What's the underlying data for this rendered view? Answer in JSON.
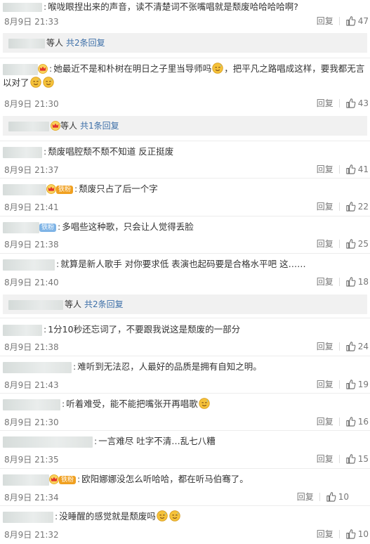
{
  "comments": [
    {
      "text": "喉咙眼捏出来的声音，读不清楚词不张嘴唱就是颓废哈哈哈哈啊?",
      "date": "8月9日 21:33",
      "reply": "回复",
      "likes": "47"
    },
    {
      "text": "她最近不是和朴树在明日之子里当导师吗",
      "text2": "，把平凡之路唱成这样，要我都无言以对了",
      "date": "8月9日 21:30",
      "reply": "回复",
      "likes": "43",
      "more_suffix": "等人",
      "more_link": "共2条回复"
    },
    {
      "text": "颓废唱腔颓不颓不知道 反正挺废",
      "date": "8月9日 21:37",
      "reply": "回复",
      "likes": "41",
      "more_suffix": "等人",
      "more_link": "共1条回复"
    },
    {
      "text": "颓废只占了后一个字",
      "date": "8月9日 21:41",
      "reply": "回复",
      "likes": "22",
      "badge": "铁粉"
    },
    {
      "text": "多唱些这种歌，只会让人觉得丢脸",
      "date": "8月9日 21:38",
      "reply": "回复",
      "likes": "25",
      "badge": "铁粉"
    },
    {
      "text": "就算是新人歌手 对你要求低 表演也起码要是合格水平吧 这……",
      "date": "8月9日 21:40",
      "reply": "回复",
      "likes": "18"
    },
    {
      "text": "1分10秒还忘词了，不要跟我说这是颓废的一部分",
      "date": "8月9日 21:38",
      "reply": "回复",
      "likes": "24",
      "more_suffix": "等人",
      "more_link": "共2条回复"
    },
    {
      "text": "难听到无法忍，人最好的品质是拥有自知之明。",
      "date": "8月9日 21:43",
      "reply": "回复",
      "likes": "19"
    },
    {
      "text": "听着难受，能不能把嘴张开再唱歌",
      "date": "8月9日 21:30",
      "reply": "回复",
      "likes": "16"
    },
    {
      "text": "一言难尽 吐字不清…乱七八糟",
      "date": "8月9日 21:35",
      "reply": "回复",
      "likes": "15"
    },
    {
      "text": "欧阳娜娜没怎么听哈哈，都在听马伯骞了。",
      "date": "8月9日 21:34",
      "reply": "回复",
      "likes": "10",
      "badge": "铁粉"
    },
    {
      "text": "没睡醒的感觉就是颓废吗",
      "date": "8月9日 21:32",
      "reply": "回复",
      "likes": "10"
    }
  ],
  "colors": {
    "link": "#3d6fa8",
    "fan_badge_orange": "#f0a020",
    "fan_badge_blue": "#7fb4e6",
    "crown": "#f7b733",
    "emoji": "#f5c23a"
  },
  "icons": {
    "like": "thumbs-up-icon",
    "crown": "crown-badge-icon",
    "emoji": "sweat-smile-emoji-icon"
  }
}
